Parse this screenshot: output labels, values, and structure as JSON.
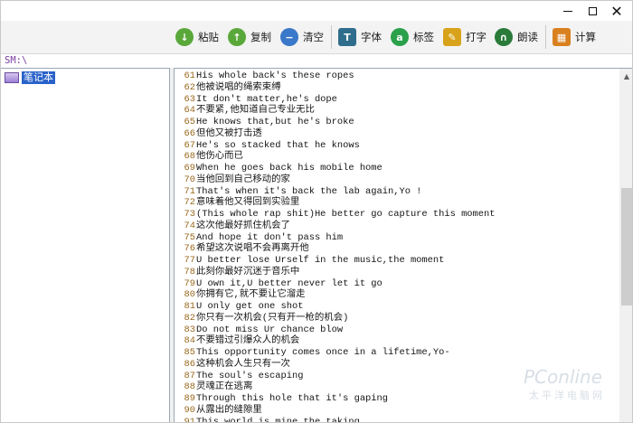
{
  "window": {
    "controls": {
      "minimize": "minimize",
      "maximize": "maximize",
      "close": "✕"
    }
  },
  "toolbar": {
    "buttons": [
      {
        "id": "paste",
        "label": "粘贴",
        "icon": "paste-down-arrow-icon",
        "color": "#5aa83a",
        "glyph": "↓"
      },
      {
        "id": "copy",
        "label": "复制",
        "icon": "copy-up-arrow-icon",
        "color": "#5aa83a",
        "glyph": "↑"
      },
      {
        "id": "clear",
        "label": "清空",
        "icon": "clear-minus-icon",
        "color": "#3a78c9",
        "glyph": "−"
      },
      {
        "id": "font",
        "label": "字体",
        "icon": "font-tt-icon",
        "color": "#2f6d8c",
        "glyph": "T"
      },
      {
        "id": "tag",
        "label": "标签",
        "icon": "tag-a-icon",
        "color": "#2aa04a",
        "glyph": "a"
      },
      {
        "id": "type",
        "label": "打字",
        "icon": "typing-pencil-icon",
        "color": "#d8a21a",
        "glyph": "✎"
      },
      {
        "id": "read",
        "label": "朗读",
        "icon": "headphones-icon",
        "color": "#2a7a3a",
        "glyph": "∩"
      },
      {
        "id": "calc",
        "label": "计算",
        "icon": "calculator-icon",
        "color": "#d9801e",
        "glyph": "▦"
      }
    ]
  },
  "path": {
    "text": "SM:\\"
  },
  "tree": {
    "root_label": "笔记本",
    "icon": "notebook-icon"
  },
  "editor": {
    "lines": [
      {
        "n": "61",
        "t": "His whole back's  these ropes"
      },
      {
        "n": "62",
        "t": "他被说唱的绳索束缚"
      },
      {
        "n": "63",
        "t": "It don't matter,he's dope"
      },
      {
        "n": "64",
        "t": "不要紧,他知道自己专业无比"
      },
      {
        "n": "65",
        "t": "He knows that,but he's broke"
      },
      {
        "n": "66",
        "t": "但他又被打击透"
      },
      {
        "n": "67",
        "t": "He's so stacked that he knows"
      },
      {
        "n": "68",
        "t": "他伤心而已"
      },
      {
        "n": "69",
        "t": "When he goes back  his mobile home"
      },
      {
        "n": "70",
        "t": "当他回到自己移动的家"
      },
      {
        "n": "71",
        "t": "That's when it's back  the lab again,Yo !"
      },
      {
        "n": "72",
        "t": "意味着他又得回到实验里"
      },
      {
        "n": "73",
        "t": "(This whole rap shit)He better go capture this moment"
      },
      {
        "n": "74",
        "t": "这次他最好抓住机会了"
      },
      {
        "n": "75",
        "t": "And hope it don't pass him"
      },
      {
        "n": "76",
        "t": "希望这次说唱不会再离开他"
      },
      {
        "n": "77",
        "t": "U better lose Urself in the music,the moment"
      },
      {
        "n": "78",
        "t": "此刻你最好沉迷于音乐中"
      },
      {
        "n": "79",
        "t": "U own it,U better never let it go"
      },
      {
        "n": "80",
        "t": "你拥有它,就不要让它溜走"
      },
      {
        "n": "81",
        "t": "U only get one shot"
      },
      {
        "n": "82",
        "t": "你只有一次机会(只有开一枪的机会)"
      },
      {
        "n": "83",
        "t": "Do not miss Ur chance  blow"
      },
      {
        "n": "84",
        "t": "不要错过引爆众人的机会"
      },
      {
        "n": "85",
        "t": "This opportunity comes once in a lifetime,Yo-"
      },
      {
        "n": "86",
        "t": "这种机会人生只有一次"
      },
      {
        "n": "87",
        "t": "The soul's escaping"
      },
      {
        "n": "88",
        "t": "灵魂正在逃离"
      },
      {
        "n": "89",
        "t": "Through this hole that it's gaping"
      },
      {
        "n": "90",
        "t": "从露出的缝隙里"
      },
      {
        "n": "91",
        "t": "This world is mine  the taking"
      }
    ]
  },
  "watermark": {
    "brand": "PConline",
    "sub": "太平洋电脑网"
  }
}
